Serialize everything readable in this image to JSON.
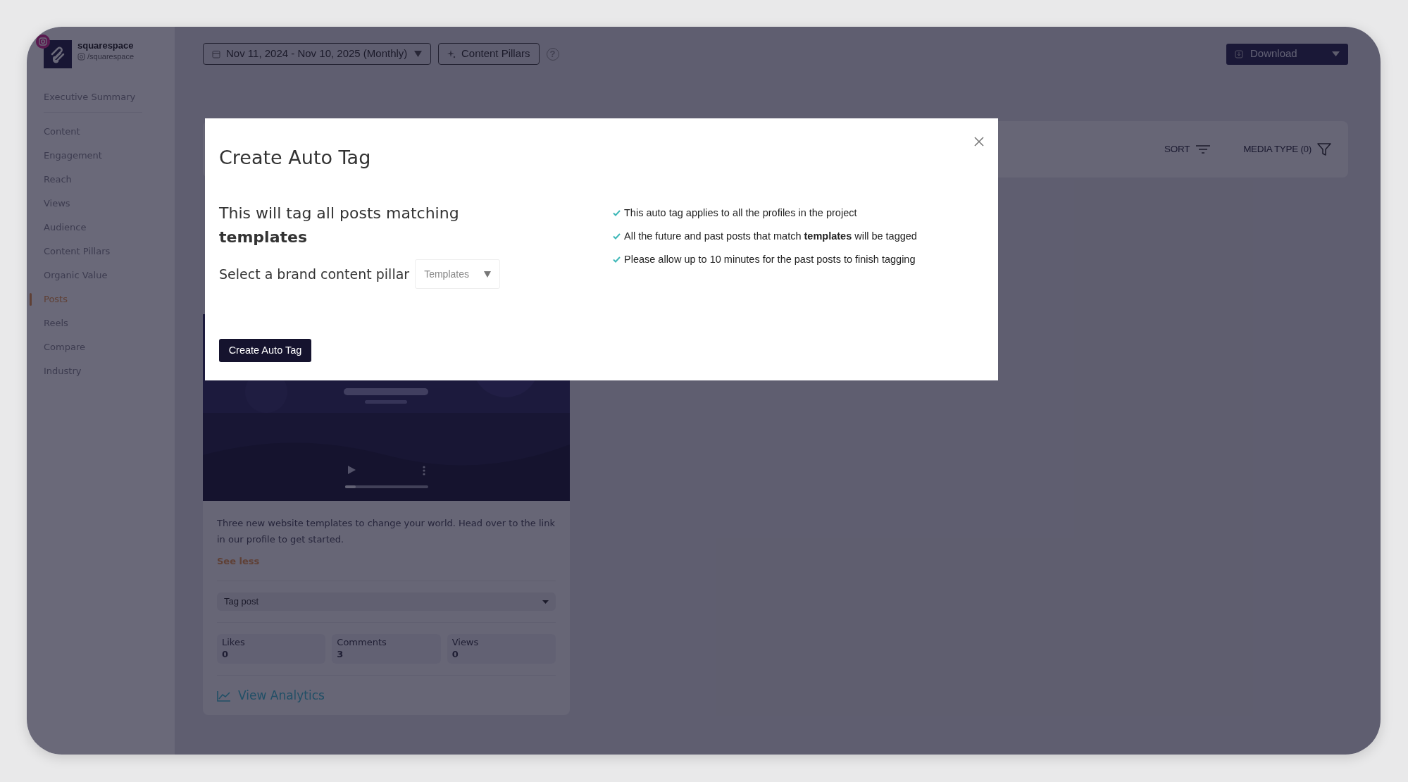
{
  "profile": {
    "name": "squarespace",
    "handle": "/squarespace"
  },
  "sidebar": {
    "items": [
      {
        "label": "Executive Summary",
        "selected": false
      },
      {
        "label": "Content",
        "selected": false
      },
      {
        "label": "Engagement",
        "selected": false
      },
      {
        "label": "Reach",
        "selected": false
      },
      {
        "label": "Views",
        "selected": false
      },
      {
        "label": "Audience",
        "selected": false
      },
      {
        "label": "Content Pillars",
        "selected": false
      },
      {
        "label": "Organic Value",
        "selected": false
      },
      {
        "label": "Posts",
        "selected": true
      },
      {
        "label": "Reels",
        "selected": false
      },
      {
        "label": "Compare",
        "selected": false
      },
      {
        "label": "Industry",
        "selected": false
      }
    ]
  },
  "toolbar": {
    "date_range": "Nov 11, 2024 - Nov 10, 2025 (Monthly)",
    "pillars_button": "Content Pillars",
    "help": "?",
    "download_button": "Download"
  },
  "filters": {
    "sort": "SORT",
    "media_type": "MEDIA TYPE (0)"
  },
  "post": {
    "video": {
      "level": 0.13
    },
    "caption": "Three new website templates to change your world. Head over to the link in our profile to get started.",
    "see_less": "See less",
    "tag_select": "Tag post",
    "stats": [
      {
        "label": "Likes",
        "value": "0"
      },
      {
        "label": "Comments",
        "value": "3"
      },
      {
        "label": "Views",
        "value": "0"
      }
    ],
    "analytics_link": "View Analytics"
  },
  "modal": {
    "title": "Create Auto Tag",
    "message": "This will tag all posts matching **templates**",
    "select_label": "Select a brand content pillar",
    "select_value": "Templates",
    "notes": [
      "This auto tag applies to all the profiles in the project",
      "All the future and past posts that match **templates** will be tagged",
      "Please allow up to 10 minutes for the past posts to finish tagging"
    ],
    "button": "Create Auto Tag"
  }
}
